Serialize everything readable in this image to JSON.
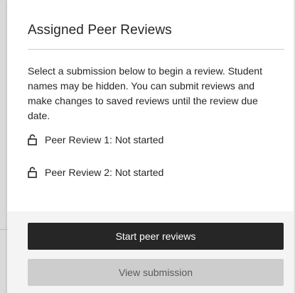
{
  "panel": {
    "title": "Assigned Peer Reviews",
    "description": "Select a submission below to begin a review. Student names may be hidden. You can submit reviews and make changes to saved reviews until the review due date.",
    "reviews": [
      {
        "label": "Peer Review 1: Not started",
        "icon": "unlocked-icon"
      },
      {
        "label": "Peer Review 2: Not started",
        "icon": "unlocked-icon"
      }
    ]
  },
  "footer": {
    "start_label": "Start peer reviews",
    "view_label": "View submission"
  },
  "colors": {
    "primary_button": "#262626",
    "secondary_button": "#cdcdcd",
    "text": "#262626",
    "footer_bg": "#f4f4f4"
  }
}
